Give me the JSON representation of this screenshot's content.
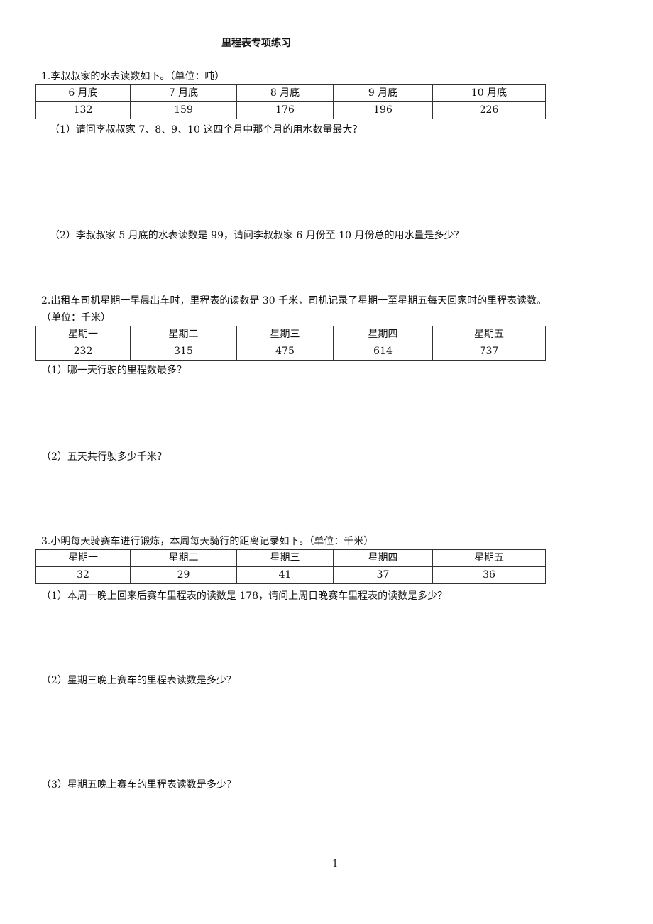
{
  "title": "里程表专项练习",
  "sections": [
    {
      "prompt": "1.李叔叔家的水表读数如下。（单位：吨）",
      "table": {
        "headers": [
          "6 月底",
          "7 月底",
          "8 月底",
          "9 月底",
          "10 月底"
        ],
        "values": [
          "132",
          "159",
          "176",
          "196",
          "226"
        ]
      },
      "questions": [
        "（1）请问李叔叔家 7、8、9、10 这四个月中那个月的用水数量最大？",
        "（2）李叔叔家 5 月底的水表读数是 99，请问李叔叔家 6 月份至 10 月份总的用水量是多少？"
      ]
    },
    {
      "prompt": "2.出租车司机星期一早晨出车时，里程表的读数是 30 千米，司机记录了星期一至星期五每天回家时的里程表读数。",
      "unit": "（单位：千米）",
      "table": {
        "headers": [
          "星期一",
          "星期二",
          "星期三",
          "星期四",
          "星期五"
        ],
        "values": [
          "232",
          "315",
          "475",
          "614",
          "737"
        ]
      },
      "questions": [
        "（1）哪一天行驶的里程数最多？",
        "（2）五天共行驶多少千米？"
      ]
    },
    {
      "prompt": "3.小明每天骑赛车进行锻炼，本周每天骑行的距离记录如下。（单位：千米）",
      "table": {
        "headers": [
          "星期一",
          "星期二",
          "星期三",
          "星期四",
          "星期五"
        ],
        "values": [
          "32",
          "29",
          "41",
          "37",
          "36"
        ]
      },
      "questions": [
        "（1）本周一晚上回来后赛车里程表的读数是 178，请问上周日晚赛车里程表的读数是多少？",
        "（2）星期三晚上赛车的里程表读数是多少？",
        "（3）星期五晚上赛车的里程表读数是多少？"
      ]
    }
  ],
  "page_number": "1"
}
